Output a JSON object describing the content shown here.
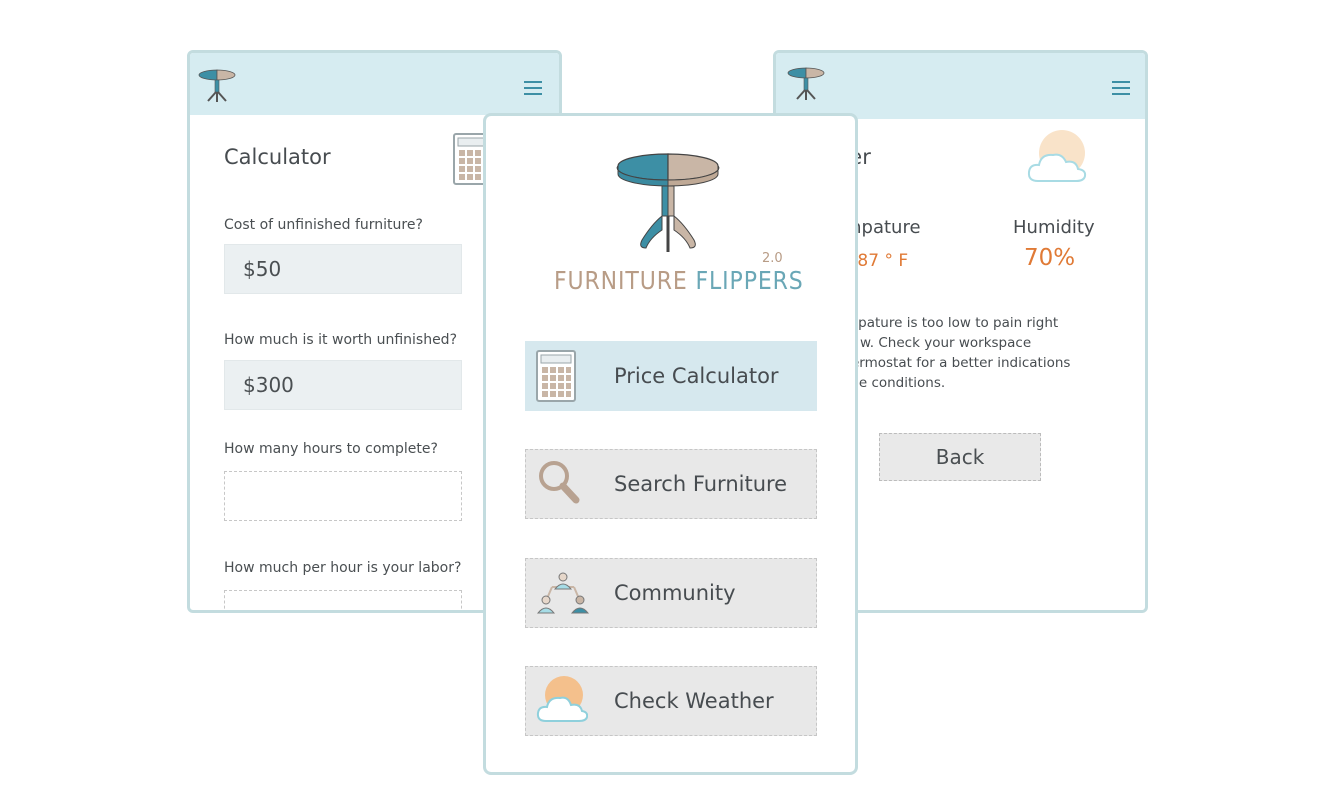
{
  "calculator": {
    "title": "Calculator",
    "questions": [
      {
        "label": "Cost of unfinished furniture?",
        "value": "$50"
      },
      {
        "label": "How much is it worth unfinished?",
        "value": "$300"
      },
      {
        "label": "How many hours to complete?",
        "value": ""
      },
      {
        "label": "How much per hour is your labor?",
        "value": ""
      }
    ]
  },
  "weather": {
    "title_partial": "her",
    "temperature_label_partial": "mpature",
    "temperature_value_partial": ".87 ° F",
    "humidity_label": "Humidity",
    "humidity_value": "70%",
    "message_lines": [
      "mpature is too low to pain right",
      "w. Check your workspace",
      "ermostat for a better indications",
      "the conditions."
    ],
    "back_label": "Back"
  },
  "main": {
    "brand_word1": "FURNITURE",
    "brand_word2": "FLIPPERS",
    "version": "2.0",
    "menu": [
      {
        "label": "Price Calculator",
        "icon": "calculator-icon",
        "active": true
      },
      {
        "label": "Search Furniture",
        "icon": "search-icon",
        "active": false
      },
      {
        "label": "Community",
        "icon": "community-icon",
        "active": false
      },
      {
        "label": "Check Weather",
        "icon": "weather-icon",
        "active": false
      }
    ]
  },
  "colors": {
    "header_bg": "#d6ecf1",
    "border": "#c3dcdf",
    "accent_orange": "#e07a36",
    "teal": "#3d8fa5",
    "tan": "#b89c86"
  }
}
